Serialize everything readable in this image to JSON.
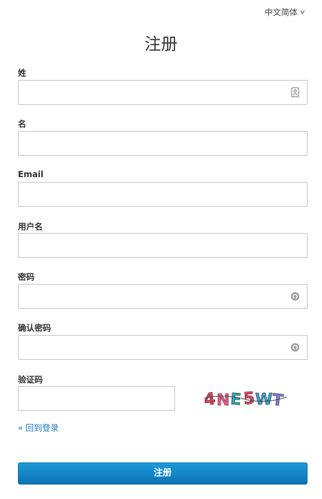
{
  "language": {
    "label": "中文简体",
    "chevron": "v"
  },
  "title": "注册",
  "fields": {
    "last_name": {
      "label": "姓",
      "value": "",
      "icon": "contact-card-icon"
    },
    "first_name": {
      "label": "名",
      "value": ""
    },
    "email": {
      "label": "Email",
      "value": ""
    },
    "username": {
      "label": "用户名",
      "value": ""
    },
    "password": {
      "label": "密码",
      "value": "",
      "icon": "password-manager-icon"
    },
    "confirm_password": {
      "label": "确认密码",
      "value": "",
      "icon": "password-manager-icon"
    },
    "captcha": {
      "label": "验证码",
      "value": "",
      "image_text": "4NE5WT"
    }
  },
  "back_link": "« 回到登录",
  "submit_label": "注册",
  "colors": {
    "link": "#1a7ab8",
    "button_top": "#1d9ad8",
    "button_bottom": "#0b73b4",
    "border": "#c4c4c4"
  }
}
